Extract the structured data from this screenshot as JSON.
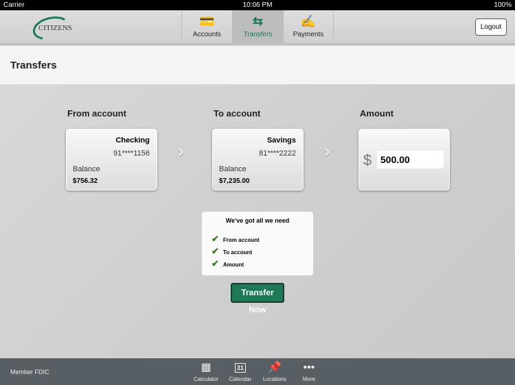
{
  "status": {
    "carrier": "Carrier",
    "time": "10:06 PM",
    "battery": "100%"
  },
  "nav": {
    "logo": "CITIZENS",
    "tabs": [
      {
        "label": "Accounts",
        "icon": "credit-card-icon"
      },
      {
        "label": "Transfers",
        "icon": "transfer-arrows-icon",
        "active": true
      },
      {
        "label": "Payments",
        "icon": "check-pen-icon"
      }
    ],
    "logout": "Logout",
    "accent": "#1e7a5a"
  },
  "page": {
    "title": "Transfers"
  },
  "from": {
    "label": "From account",
    "type": "Checking",
    "number": "91****1156",
    "balance_label": "Balance",
    "balance": "$756.32"
  },
  "to": {
    "label": "To account",
    "type": "Savings",
    "number": "81****2222",
    "balance_label": "Balance",
    "balance": "$7,235.00"
  },
  "amount": {
    "label": "Amount",
    "currency": "$",
    "value": "500.00"
  },
  "checklist": {
    "title": "We've got all we need",
    "items": [
      "From account",
      "To account",
      "Amount"
    ]
  },
  "transfer_button": "Transfer Now",
  "footer": {
    "fdic": "Member FDIC",
    "items": [
      {
        "label": "Calculator",
        "icon": "calculator-icon"
      },
      {
        "label": "Calendar",
        "icon": "calendar-icon",
        "day": "31"
      },
      {
        "label": "Locations",
        "icon": "pushpin-icon"
      },
      {
        "label": "More",
        "icon": "more-icon"
      }
    ]
  }
}
